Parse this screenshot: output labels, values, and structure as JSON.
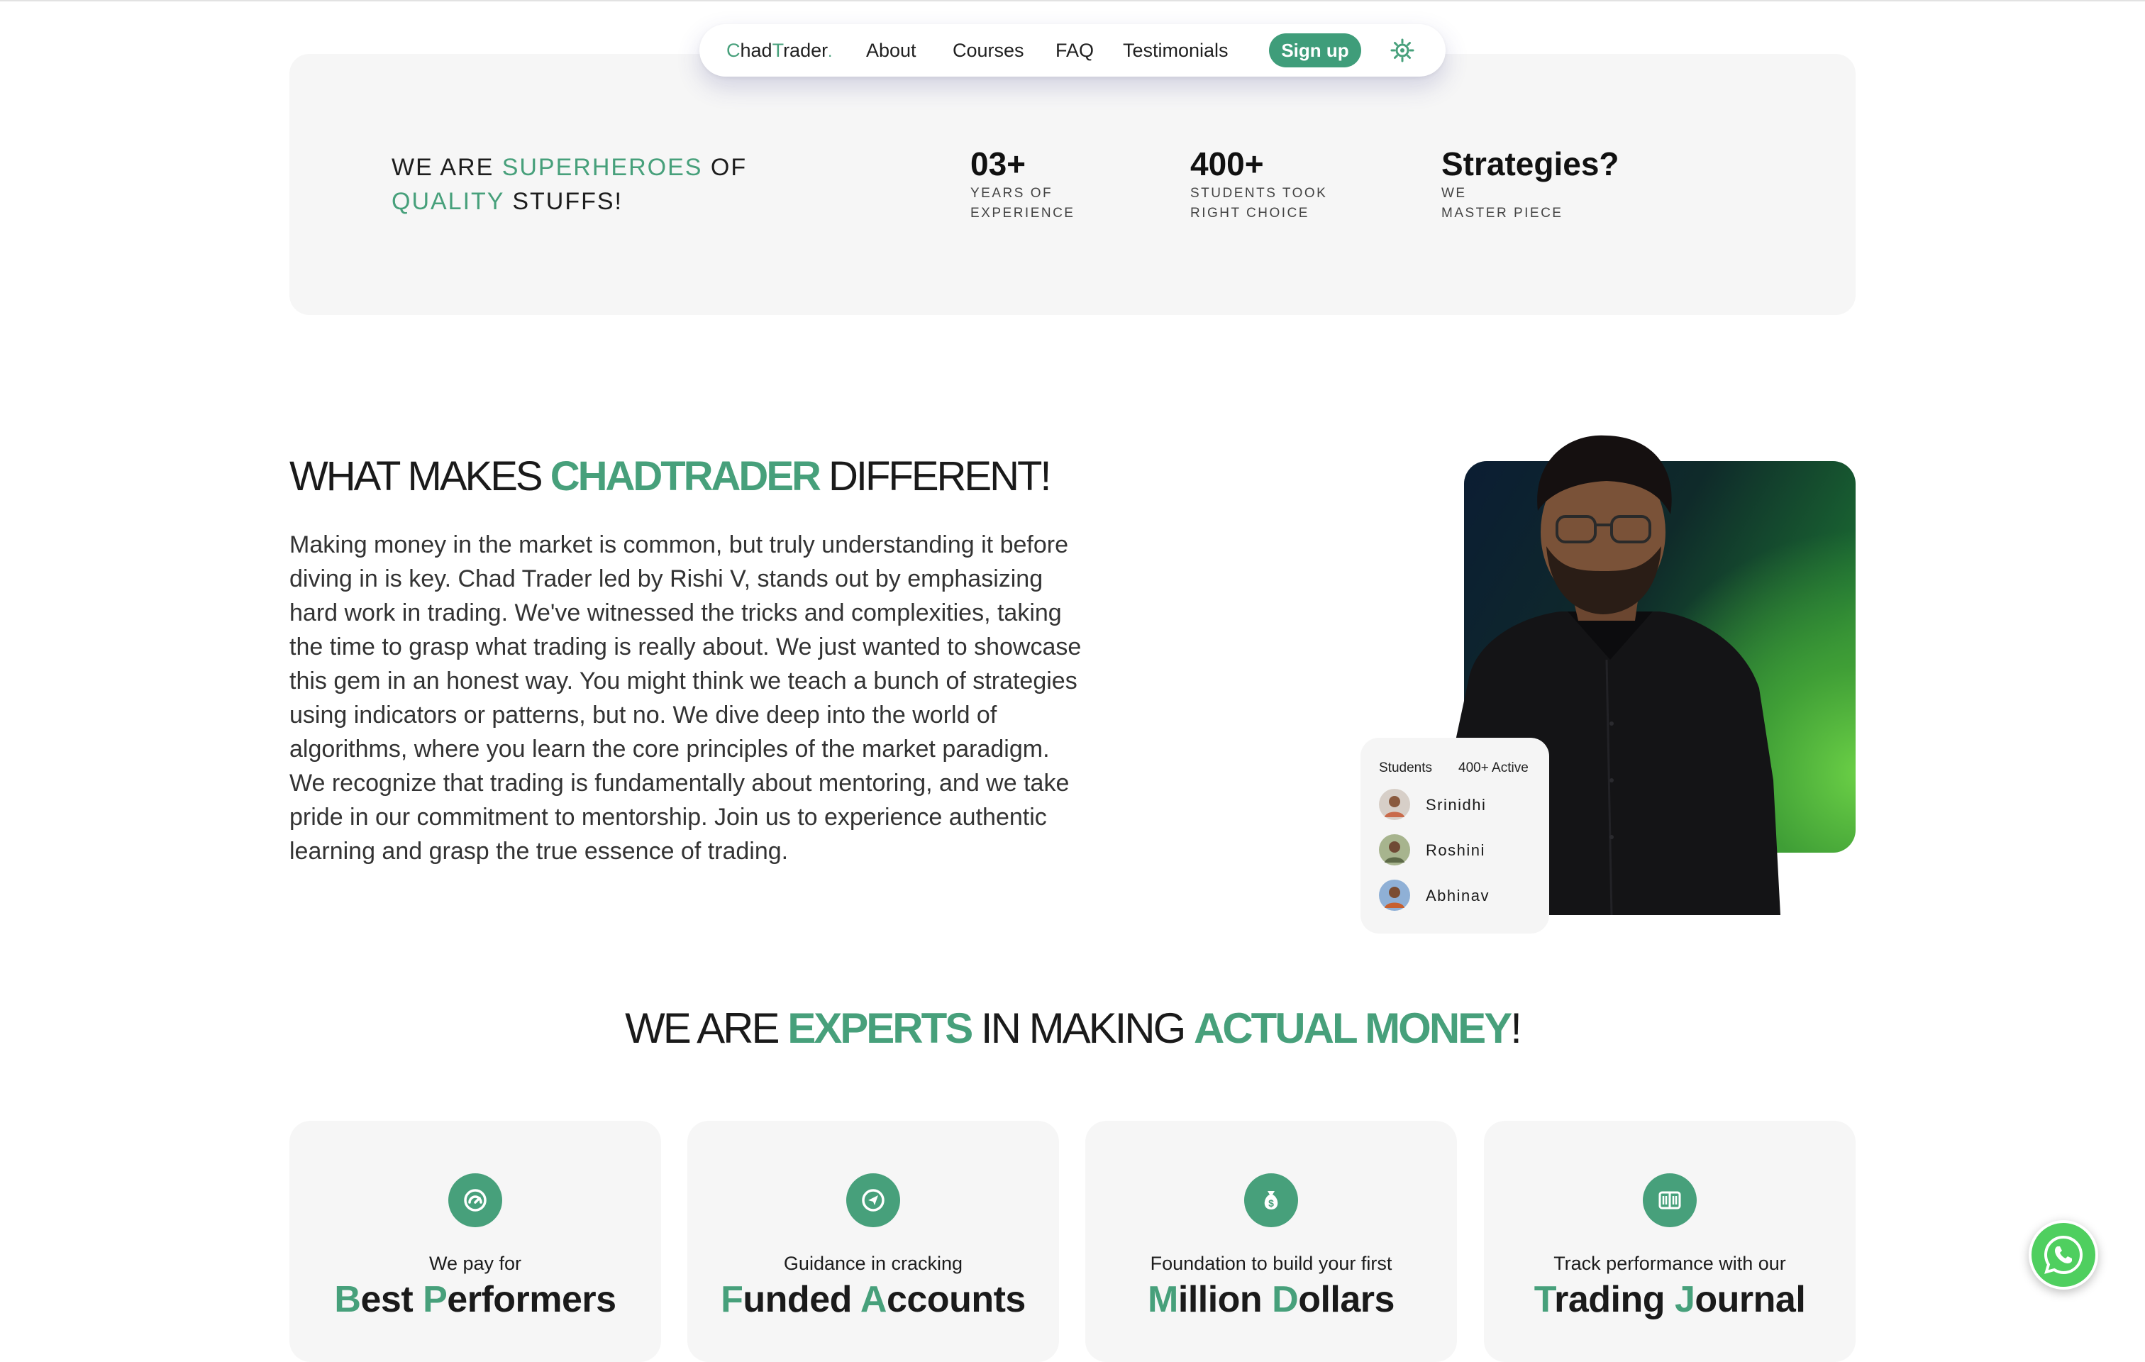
{
  "nav": {
    "brand_first": "C",
    "brand_mid": "had",
    "brand_t": "T",
    "brand_rest": "rader",
    "brand_dot": ".",
    "about": "About",
    "courses": "Courses",
    "faq": "FAQ",
    "testimonials": "Testimonials",
    "signup": "Sign up"
  },
  "banner": {
    "tag_1": "WE ARE ",
    "tag_2": "SUPERHEROES",
    "tag_3": " OF ",
    "tag_4": "QUALITY",
    "tag_5": " STUFFS!",
    "stats": [
      {
        "big": "03+",
        "line1": "YEARS OF",
        "line2": "EXPERIENCE"
      },
      {
        "big": "400+",
        "line1": "STUDENTS TOOK",
        "line2": "RIGHT CHOICE"
      },
      {
        "big": "Strategies?",
        "line1": "WE",
        "line2": "MASTER PIECE"
      }
    ]
  },
  "different": {
    "title_1": "WHAT MAKES ",
    "title_2": "CHADTRADER",
    "title_3": " DIFFERENT!",
    "body": "Making money in the market is common, but truly understanding it before diving in is key. Chad Trader led by Rishi V, stands out by emphasizing hard work in trading. We've witnessed the tricks and complexities, taking the time to grasp what trading is really about. We just wanted to showcase this gem in an honest way. You might think we teach a bunch of strategies using indicators or patterns, but no. We dive deep into the world of algorithms, where you learn the core principles of the market paradigm. We recognize that trading is fundamentally about mentoring, and we take pride in our commitment to mentorship. Join us to experience authentic learning and grasp the true essence of trading."
  },
  "students_card": {
    "label": "Students",
    "active": "400+ Active",
    "names": [
      "Srinidhi",
      "Roshini",
      "Abhinav"
    ]
  },
  "experts": {
    "t1": "WE ARE ",
    "t2": "EXPERTS",
    "t3": " IN MAKING ",
    "t4": "ACTUAL MONEY",
    "t5": "!"
  },
  "cards": [
    {
      "sub": "We pay for",
      "h1": "B",
      "h2": "est ",
      "h3": "P",
      "h4": "erformers",
      "icon": "speedometer-icon"
    },
    {
      "sub": "Guidance in cracking",
      "h1": "F",
      "h2": "unded ",
      "h3": "A",
      "h4": "ccounts",
      "icon": "send-icon"
    },
    {
      "sub": "Foundation to build your first",
      "h1": "M",
      "h2": "illion ",
      "h3": "D",
      "h4": "ollars",
      "icon": "money-bag-icon"
    },
    {
      "sub": "Track performance with our",
      "h1": "T",
      "h2": "rading ",
      "h3": "J",
      "h4": "ournal",
      "icon": "book-icon"
    }
  ],
  "colors": {
    "accent": "#47a07b",
    "card_bg": "#f6f6f6",
    "whatsapp": "#4fcf5f"
  }
}
